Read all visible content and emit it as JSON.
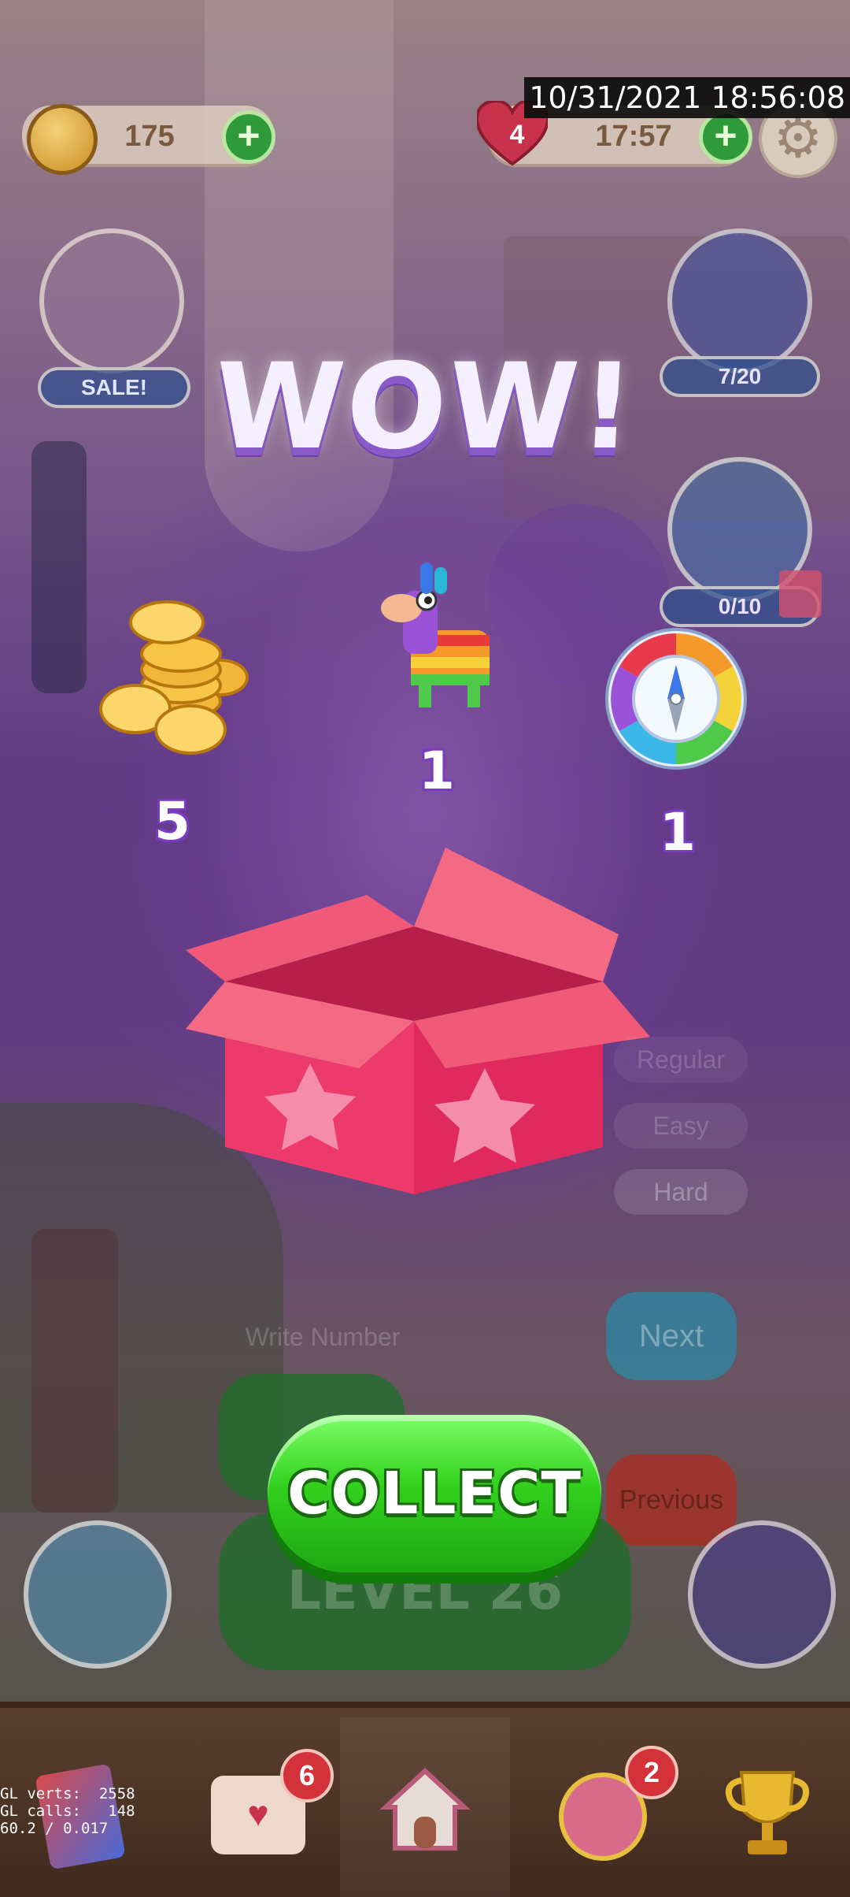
{
  "status": {
    "datetime": "10/31/2021 18:56:08"
  },
  "hud": {
    "coins": "175",
    "lives": "4",
    "timer": "17:57"
  },
  "side": {
    "sale_label": "SALE!",
    "star_progress": "7/20",
    "gem_progress": "0/10"
  },
  "popup": {
    "title": "WOW!",
    "rewards": [
      {
        "icon": "coin-stack-icon",
        "count": "5"
      },
      {
        "icon": "pinata-icon",
        "count": "1"
      },
      {
        "icon": "compass-icon",
        "count": "1"
      }
    ],
    "collect_label": "COLLECT"
  },
  "background": {
    "difficulty_options": [
      "Regular",
      "Easy",
      "Hard"
    ],
    "write_number_placeholder": "Write Number",
    "next_label": "Next",
    "previous_label": "Previous",
    "level_label": "LEVEL 26"
  },
  "bottom_nav": {
    "items": [
      {
        "icon": "cards-icon",
        "badge": ""
      },
      {
        "icon": "mail-heart-icon",
        "badge": "6"
      },
      {
        "icon": "home-icon",
        "badge": ""
      },
      {
        "icon": "team-icon",
        "badge": "2"
      },
      {
        "icon": "trophy-icon",
        "badge": ""
      }
    ]
  },
  "debug": {
    "line1": "GL verts:  2558",
    "line2": "GL calls:   148",
    "line3": "60.2 / 0.017"
  },
  "colors": {
    "collect_green": "#33d11e",
    "popup_purple": "#6d4b95",
    "notif_red": "#d4323a"
  }
}
